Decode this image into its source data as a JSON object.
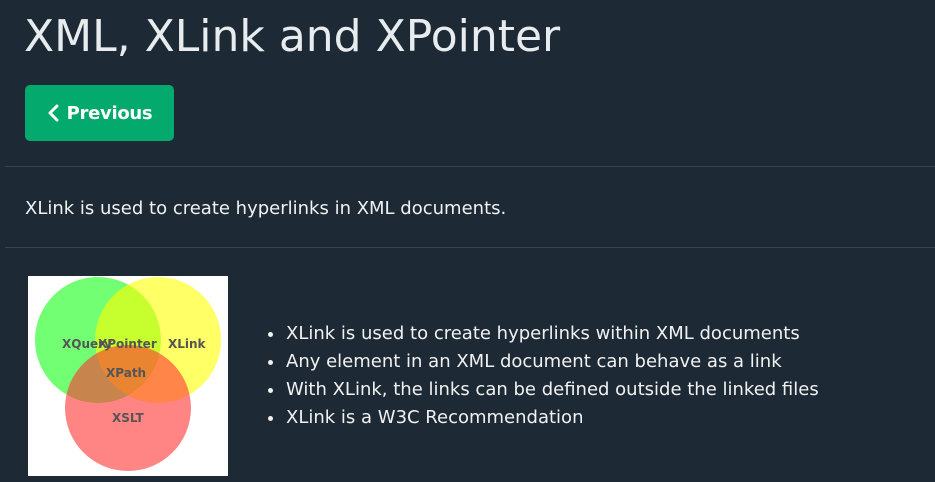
{
  "page": {
    "title": "XML, XLink and XPointer"
  },
  "navigation": {
    "previous_label": "Previous",
    "previous_icon": "chevron-left-icon"
  },
  "intro": "XLink is used to create hyperlinks in XML documents.",
  "diagram": {
    "labels": {
      "xquery": "XQuery",
      "xpointer": "XPointer",
      "xlink": "XLink",
      "xpath": "XPath",
      "xslt": "XSLT"
    }
  },
  "bullets": [
    "XLink is used to create hyperlinks within XML documents",
    "Any element in an XML document can behave as a link",
    "With XLink, the links can be defined outside the linked files",
    "XLink is a W3C Recommendation"
  ],
  "colors": {
    "background": "#1d2a35",
    "accent_green": "#04aa6d",
    "text": "#f1f1f1",
    "divider": "#38444d"
  }
}
